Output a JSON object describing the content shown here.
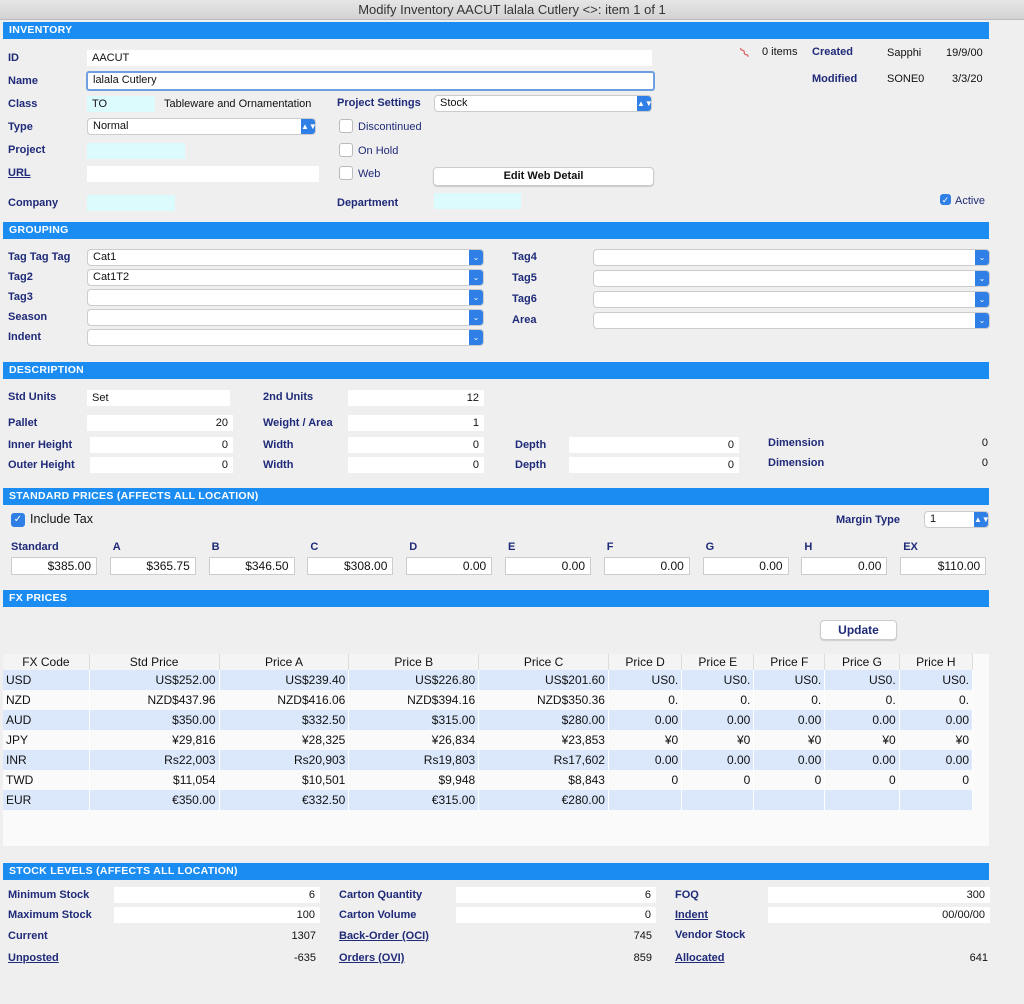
{
  "window_title": "Modify Inventory AACUT lalala Cutlery <>: item 1  of  1",
  "inventory": {
    "header": "INVENTORY",
    "id_label": "ID",
    "id": "AACUT",
    "name_label": "Name",
    "name": "lalala Cutlery",
    "class_label": "Class",
    "class_code": "TO",
    "class_desc": "Tableware and Ornamentation",
    "project_settings_label": "Project Settings",
    "project_settings": "Stock",
    "type_label": "Type",
    "type": "Normal",
    "discontinued": "Discontinued",
    "on_hold": "On Hold",
    "web": "Web",
    "project_label": "Project",
    "url_label": "URL",
    "edit_web_detail": "Edit Web Detail",
    "company_label": "Company",
    "department_label": "Department",
    "attachments": "0 items",
    "created_label": "Created",
    "created_by": "Sapphi",
    "created_date": "19/9/00",
    "modified_label": "Modified",
    "modified_by": "SONE0",
    "modified_date": "3/3/20",
    "active": "Active"
  },
  "grouping": {
    "header": "GROUPING",
    "left": [
      {
        "label": "Tag Tag Tag",
        "value": "Cat1"
      },
      {
        "label": "Tag2",
        "value": "Cat1T2"
      },
      {
        "label": "Tag3",
        "value": ""
      },
      {
        "label": "Season",
        "value": ""
      },
      {
        "label": "Indent",
        "value": ""
      }
    ],
    "right": [
      {
        "label": "Tag4",
        "value": ""
      },
      {
        "label": "Tag5",
        "value": ""
      },
      {
        "label": "Tag6",
        "value": ""
      },
      {
        "label": "Area",
        "value": ""
      }
    ]
  },
  "description": {
    "header": "DESCRIPTION",
    "std_units_label": "Std Units",
    "std_units": "Set",
    "second_units_label": "2nd Units",
    "second_units": "12",
    "pallet_label": "Pallet",
    "pallet": "20",
    "weight_label": "Weight / Area",
    "weight": "1",
    "inner_height_label": "Inner Height",
    "inner_height": "0",
    "width_label": "Width",
    "width1": "0",
    "depth_label": "Depth",
    "depth1": "0",
    "dimension_label": "Dimension",
    "dimension1": "0",
    "outer_height_label": "Outer Height",
    "outer_height": "0",
    "width2": "0",
    "depth2": "0",
    "dimension2": "0"
  },
  "prices": {
    "header": "STANDARD PRICES (AFFECTS ALL LOCATION)",
    "include_tax": "Include Tax",
    "margin_type_label": "Margin Type",
    "margin_type": "1",
    "items": [
      {
        "label": "Standard",
        "value": "$385.00"
      },
      {
        "label": "A",
        "value": "$365.75"
      },
      {
        "label": "B",
        "value": "$346.50"
      },
      {
        "label": "C",
        "value": "$308.00"
      },
      {
        "label": "D",
        "value": "0.00"
      },
      {
        "label": "E",
        "value": "0.00"
      },
      {
        "label": "F",
        "value": "0.00"
      },
      {
        "label": "G",
        "value": "0.00"
      },
      {
        "label": "H",
        "value": "0.00"
      },
      {
        "label": "EX",
        "value": "$110.00"
      }
    ]
  },
  "fx": {
    "header": "FX PRICES",
    "update": "Update",
    "columns": [
      "FX Code",
      "Std Price",
      "Price A",
      "Price B",
      "Price C",
      "Price D",
      "Price E",
      "Price F",
      "Price G",
      "Price H"
    ],
    "rows": [
      [
        "USD",
        "US$252.00",
        "US$239.40",
        "US$226.80",
        "US$201.60",
        "US0.",
        "US0.",
        "US0.",
        "US0.",
        "US0."
      ],
      [
        "NZD",
        "NZD$437.96",
        "NZD$416.06",
        "NZD$394.16",
        "NZD$350.36",
        "0.",
        "0.",
        "0.",
        "0.",
        "0."
      ],
      [
        "AUD",
        "$350.00",
        "$332.50",
        "$315.00",
        "$280.00",
        "0.00",
        "0.00",
        "0.00",
        "0.00",
        "0.00"
      ],
      [
        "JPY",
        "¥29,816",
        "¥28,325",
        "¥26,834",
        "¥23,853",
        "¥0",
        "¥0",
        "¥0",
        "¥0",
        "¥0"
      ],
      [
        "INR",
        "Rs22,003",
        "Rs20,903",
        "Rs19,803",
        "Rs17,602",
        "0.00",
        "0.00",
        "0.00",
        "0.00",
        "0.00"
      ],
      [
        "TWD",
        "$11,054",
        "$10,501",
        "$9,948",
        "$8,843",
        "0",
        "0",
        "0",
        "0",
        "0"
      ],
      [
        "EUR",
        "€350.00",
        "€332.50",
        "€315.00",
        "€280.00",
        "",
        "",
        "",
        "",
        ""
      ]
    ]
  },
  "stock": {
    "header": "STOCK LEVELS (AFFECTS ALL LOCATION)",
    "min_label": "Minimum Stock",
    "min": "6",
    "max_label": "Maximum Stock",
    "max": "100",
    "current_label": "Current",
    "current": "1307",
    "unposted_label": "Unposted",
    "unposted": "-635",
    "carton_qty_label": "Carton Quantity",
    "carton_qty": "6",
    "carton_vol_label": "Carton Volume",
    "carton_vol": "0",
    "backorder_label": "Back-Order (OCI)",
    "backorder": "745",
    "orders_label": "Orders (OVI)",
    "orders": "859",
    "foq_label": "FOQ",
    "foq": "300",
    "indent_label": "Indent",
    "indent": "00/00/00",
    "vendor_stock_label": "Vendor Stock",
    "allocated_label": "Allocated",
    "allocated": "641"
  }
}
